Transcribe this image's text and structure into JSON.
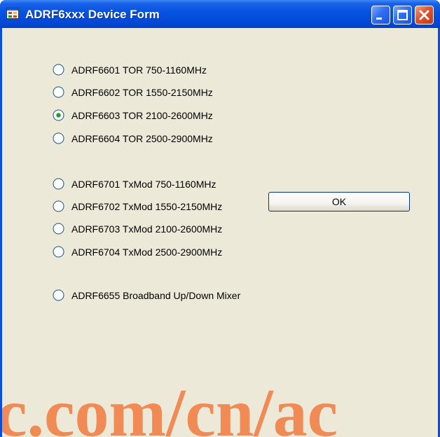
{
  "window": {
    "title": "ADRF6xxx Device Form",
    "icon": "app-form-icon",
    "controls": [
      "minimize-icon",
      "maximize-icon",
      "close-icon"
    ]
  },
  "radio_groups": [
    {
      "items": [
        {
          "label": "ADRF6601 TOR 750-1160MHz",
          "checked": false
        },
        {
          "label": "ADRF6602 TOR 1550-2150MHz",
          "checked": false
        },
        {
          "label": "ADRF6603 TOR 2100-2600MHz",
          "checked": true
        },
        {
          "label": "ADRF6604 TOR 2500-2900MHz",
          "checked": false
        }
      ]
    },
    {
      "items": [
        {
          "label": "ADRF6701 TxMod 750-1160MHz",
          "checked": false
        },
        {
          "label": "ADRF6702 TxMod 1550-2150MHz",
          "checked": false
        },
        {
          "label": "ADRF6703 TxMod 2100-2600MHz",
          "checked": false
        },
        {
          "label": "ADRF6704 TxMod 2500-2900MHz",
          "checked": false
        }
      ]
    },
    {
      "items": [
        {
          "label": "ADRF6655 Broadband Up/Down Mixer",
          "checked": false
        }
      ]
    }
  ],
  "ok_button": {
    "label": "OK"
  },
  "watermark": {
    "text": "c.com/cn/ac"
  },
  "colors": {
    "titlebar": "#0552e0",
    "client_background": "#ece9d8",
    "radio_selected_dot": "#21a121",
    "close_button": "#e0532e",
    "watermark": "#f28a55"
  }
}
